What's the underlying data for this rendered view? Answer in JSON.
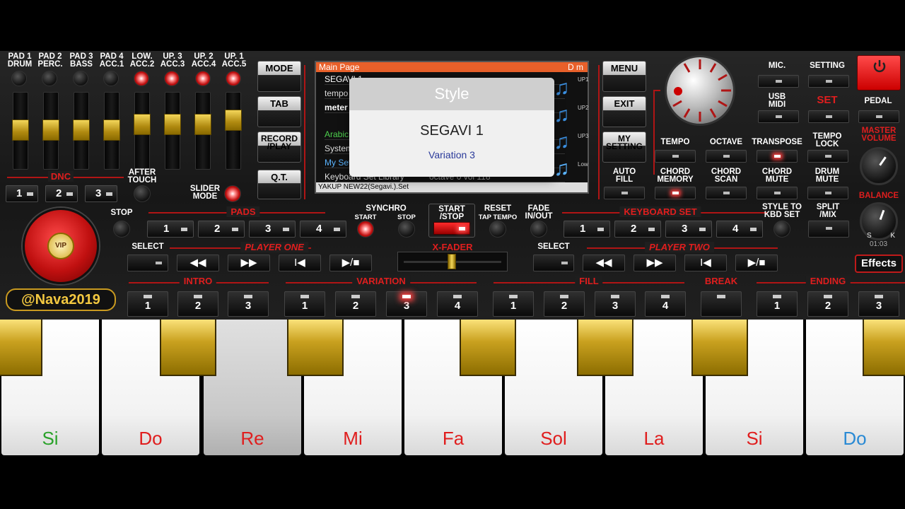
{
  "colors": {
    "accent_red": "#e01e1e",
    "gold": "#d4aa2a",
    "orange_header": "#e8602a",
    "popup_blue": "#2a3a9a"
  },
  "mixer": {
    "channels": [
      {
        "label": "PAD 1\nDRUM"
      },
      {
        "label": "PAD 2\nPERC."
      },
      {
        "label": "PAD 3\nBASS"
      },
      {
        "label": "PAD 4\nACC.1"
      },
      {
        "label": "LOW.\nACC.2"
      },
      {
        "label": "UP. 3\nACC.3"
      },
      {
        "label": "UP. 2\nACC.4"
      },
      {
        "label": "UP. 1\nACC.5"
      }
    ],
    "dnc": "DNC",
    "dnc_buttons": [
      "1",
      "2",
      "3"
    ],
    "after_touch": "AFTER\nTOUCH",
    "slider_mode": "SLIDER\nMODE"
  },
  "left_menu": {
    "mode": "MODE",
    "tab": "TAB",
    "record_play": "RECORD\n/PLAY",
    "qt": "Q.T."
  },
  "right_menu": {
    "menu": "MENU",
    "exit": "EXIT",
    "my_setting": "MY\nSETTING",
    "auto_fill": "AUTO\nFILL"
  },
  "screen": {
    "header": "Main Page",
    "key": "D m",
    "rows": [
      "SEGAVI 1",
      "tempo",
      "meter",
      "Arabic",
      "System",
      "My Setting",
      "Keyboard Set Library"
    ],
    "row_values": [
      "",
      "",
      "",
      "",
      "",
      "",
      "octave  0    vol 118"
    ],
    "right_labels": [
      "UP1",
      "UP2",
      "UP3",
      "Low"
    ],
    "footer": "YAKUP NEW22(Segavi.).Set"
  },
  "popup": {
    "title": "Style",
    "name": "SEGAVI 1",
    "variation": "Variation 3"
  },
  "right_panel": {
    "mic": "MIC.",
    "setting": "SETTING",
    "usb_midi": "USB\nMIDI",
    "set": "SET",
    "pedal": "PEDAL",
    "tempo": "TEMPO",
    "octave": "OCTAVE",
    "transpose": "TRANSPOSE",
    "tempo_lock": "TEMPO\nLOCK",
    "chord_memory": "CHORD\nMEMORY",
    "chord_scan": "CHORD\nSCAN",
    "chord_mute": "CHORD\nMUTE",
    "drum_mute": "DRUM\nMUTE",
    "master_volume": "MASTER\nVOLUME",
    "balance": "BALANCE",
    "s": "S",
    "k": "K",
    "time": "01:03",
    "effects": "Effects"
  },
  "pads_row": {
    "stop": "STOP",
    "pads": "PADS",
    "pad_buttons": [
      "1",
      "2",
      "3",
      "4"
    ],
    "synchro": "SYNCHRO",
    "synchro_start": "START",
    "synchro_stop": "STOP",
    "start_stop": "START\n/STOP",
    "reset": "RESET",
    "tap_tempo": "TAP TEMPO",
    "fade": "FADE\nIN/OUT",
    "keyboard_set": "KEYBOARD SET",
    "kbd_buttons": [
      "1",
      "2",
      "3",
      "4"
    ],
    "style_to_kbd": "STYLE TO\nKBD SET",
    "split_mix": "SPLIT\n/MIX"
  },
  "player_row": {
    "select": "SELECT",
    "player_one": "PLAYER ONE",
    "x_fader": "X-FADER",
    "player_two": "PLAYER TWO",
    "transport": [
      "◀◀",
      "▶▶",
      "I◀",
      "▶/■"
    ]
  },
  "style_row": {
    "intro": "INTRO",
    "intro_buttons": [
      "1",
      "2",
      "3"
    ],
    "variation": "VARIATION",
    "variation_buttons": [
      "1",
      "2",
      "3",
      "4"
    ],
    "fill": "FILL",
    "fill_buttons": [
      "1",
      "2",
      "3",
      "4"
    ],
    "break": "BREAK",
    "ending": "ENDING",
    "ending_buttons": [
      "1",
      "2",
      "3"
    ]
  },
  "branding": {
    "vip": "VIP",
    "watermark": "@Nava2019"
  },
  "keys": [
    {
      "label": "Si",
      "color": "#2aa22a"
    },
    {
      "label": "Do",
      "color": "#e01e1e"
    },
    {
      "label": "Re",
      "color": "#e01e1e"
    },
    {
      "label": "Mi",
      "color": "#e01e1e"
    },
    {
      "label": "Fa",
      "color": "#e01e1e"
    },
    {
      "label": "Sol",
      "color": "#e01e1e"
    },
    {
      "label": "La",
      "color": "#e01e1e"
    },
    {
      "label": "Si",
      "color": "#e01e1e"
    },
    {
      "label": "Do",
      "color": "#2a8ad4"
    }
  ]
}
